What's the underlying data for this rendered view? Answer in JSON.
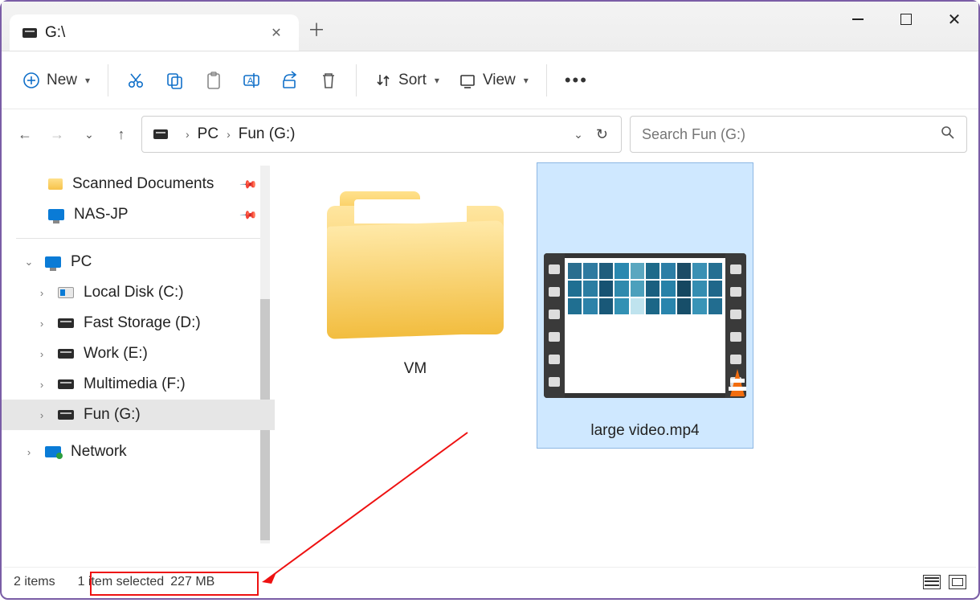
{
  "tab": {
    "title": "G:\\"
  },
  "toolbar": {
    "new_label": "New",
    "sort_label": "Sort",
    "view_label": "View"
  },
  "breadcrumb": {
    "pc": "PC",
    "drive": "Fun (G:)"
  },
  "search": {
    "placeholder": "Search Fun (G:)"
  },
  "sidebar": {
    "scanned": "Scanned Documents",
    "nas": "NAS-JP",
    "pc": "PC",
    "drives": [
      {
        "label": "Local Disk (C:)"
      },
      {
        "label": "Fast Storage (D:)"
      },
      {
        "label": "Work (E:)"
      },
      {
        "label": "Multimedia (F:)"
      },
      {
        "label": "Fun (G:)"
      }
    ],
    "network": "Network"
  },
  "items": {
    "folder": "VM",
    "video": "large video.mp4"
  },
  "status": {
    "count": "2 items",
    "selection": "1 item selected",
    "size": "227 MB"
  }
}
